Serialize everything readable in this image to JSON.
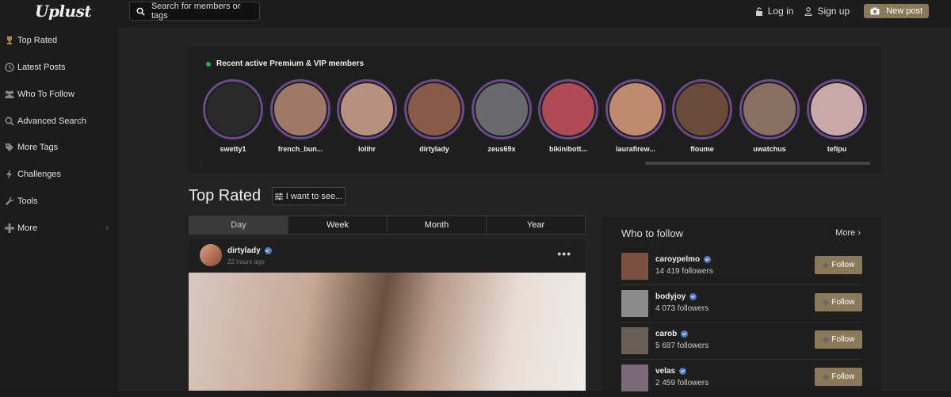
{
  "header": {
    "logo": "Uplust",
    "search_placeholder": "Search for members or tags",
    "login": "Log in",
    "signup": "Sign up",
    "new_post": "New post"
  },
  "sidebar": {
    "items": [
      {
        "label": "Top Rated",
        "icon": "trophy-icon"
      },
      {
        "label": "Latest Posts",
        "icon": "clock-icon"
      },
      {
        "label": "Who To Follow",
        "icon": "users-icon"
      },
      {
        "label": "Advanced Search",
        "icon": "search-icon"
      },
      {
        "label": "More Tags",
        "icon": "tag-icon"
      },
      {
        "label": "Challenges",
        "icon": "bolt-icon"
      },
      {
        "label": "Tools",
        "icon": "wrench-icon"
      },
      {
        "label": "More",
        "icon": "plus-icon"
      }
    ]
  },
  "stories": {
    "title": "Recent active Premium & VIP members",
    "members": [
      {
        "name": "swetty1",
        "color": "#2a2a2a"
      },
      {
        "name": "french_bun...",
        "color": "#a07868"
      },
      {
        "name": "lolihr",
        "color": "#b89080"
      },
      {
        "name": "dirtylady",
        "color": "#8a5a48"
      },
      {
        "name": "zeus69x",
        "color": "#6a6a6e"
      },
      {
        "name": "bikinibott...",
        "color": "#b04a55"
      },
      {
        "name": "laurafirew...",
        "color": "#c08a70"
      },
      {
        "name": "floume",
        "color": "#6a4a38"
      },
      {
        "name": "uwatchus",
        "color": "#8a7062"
      },
      {
        "name": "tefipu",
        "color": "#c8a8a8"
      }
    ]
  },
  "main": {
    "title": "Top Rated",
    "filter_label": "I want to see...",
    "tabs": [
      {
        "label": "Day",
        "active": true
      },
      {
        "label": "Week",
        "active": false
      },
      {
        "label": "Month",
        "active": false
      },
      {
        "label": "Year",
        "active": false
      }
    ],
    "post": {
      "author": "dirtylady",
      "time": "22 hours ago",
      "menu": "•••"
    }
  },
  "who_to_follow": {
    "title": "Who to follow",
    "more": "More",
    "follow_label": "Follow",
    "users": [
      {
        "name": "caroypelmo",
        "followers": "14 419 followers",
        "color": "#7a5040"
      },
      {
        "name": "bodyjoy",
        "followers": "4 073 followers",
        "color": "#8a8a8a"
      },
      {
        "name": "carob",
        "followers": "5 687 followers",
        "color": "#6a5e58"
      },
      {
        "name": "velas",
        "followers": "2 459 followers",
        "color": "#7a6a7a"
      }
    ]
  }
}
